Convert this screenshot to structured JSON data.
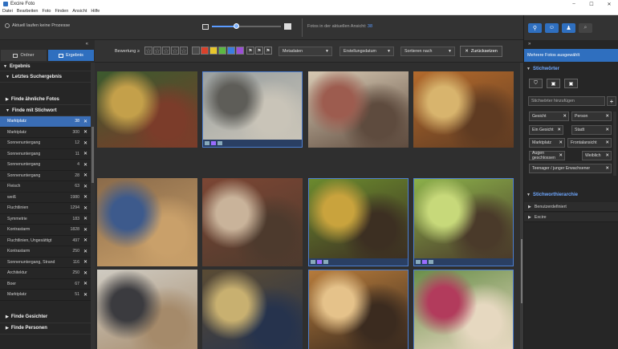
{
  "window": {
    "title": "Excire Foto",
    "minimize": "–",
    "maximize": "☐",
    "close": "✕"
  },
  "menu": [
    "Datei",
    "Bearbeiten",
    "Foto",
    "Finden",
    "Ansicht",
    "Hilfe"
  ],
  "toolbar": {
    "process_status": "Aktuell laufen keine Prozesse",
    "zoom_level": 0.35,
    "count_label": "Fotos in der aktuellen Ansicht:",
    "count_value": "38"
  },
  "left_tabs": [
    {
      "label": "Ordner",
      "active": false
    },
    {
      "label": "Ergebnis",
      "active": true
    }
  ],
  "left_panel": {
    "collapse": "«",
    "results_section": "Ergebnis",
    "last_search": "Letztes Suchergebnis",
    "similar": "Finde ähnliche Fotos",
    "by_keyword": "Finde mit Stichwort",
    "keyword_rows": [
      {
        "label": "Marktplatz",
        "count": "38",
        "selected": true
      },
      {
        "label": "Marktplatz",
        "count": "300",
        "selected": false
      },
      {
        "label": "Sonnenuntergang",
        "count": "12",
        "selected": false
      },
      {
        "label": "Sonnenuntergang",
        "count": "11",
        "selected": false
      },
      {
        "label": "Sonnenuntergang",
        "count": "4",
        "selected": false
      },
      {
        "label": "Sonnenuntergang",
        "count": "28",
        "selected": false
      },
      {
        "label": "Fleisch",
        "count": "63",
        "selected": false
      },
      {
        "label": "weiß",
        "count": "1980",
        "selected": false
      },
      {
        "label": "Fluchtlinien",
        "count": "1294",
        "selected": false
      },
      {
        "label": "Symmetrie",
        "count": "183",
        "selected": false
      },
      {
        "label": "Kontrastarm",
        "count": "1828",
        "selected": false
      },
      {
        "label": "Fluchtlinien, Ungesättigt",
        "count": "497",
        "selected": false
      },
      {
        "label": "Kontrastarm",
        "count": "250",
        "selected": false
      },
      {
        "label": "Sonnenuntergang, Strand",
        "count": "116",
        "selected": false
      },
      {
        "label": "Architektur",
        "count": "250",
        "selected": false
      },
      {
        "label": "Boer",
        "count": "67",
        "selected": false
      },
      {
        "label": "Marktplatz",
        "count": "51",
        "selected": false
      }
    ],
    "faces": "Finde Gesichter",
    "persons": "Finde Personen"
  },
  "filterbar": {
    "rating_label": "Bewertung  ≥",
    "stars": [
      "☆",
      "☆",
      "☆",
      "☆",
      "☆"
    ],
    "color_labels": [
      "#4a4a4a",
      "#d9412b",
      "#e8c62c",
      "#5cb843",
      "#3b7de0",
      "#9b4fd6"
    ],
    "flags": [
      "⚑",
      "⚑",
      "⚑"
    ],
    "metadata": "Metadaten",
    "date": "Erstellungsdatum",
    "sort": "Sortieren nach",
    "reset": "Zurücksetzen"
  },
  "photos": [
    {
      "colors": [
        "#3b5a2e",
        "#c4a04a",
        "#7b3c2a"
      ],
      "selected": false
    },
    {
      "colors": [
        "#9aa0a0",
        "#5e5d58",
        "#c9c4b8"
      ],
      "selected": true
    },
    {
      "colors": [
        "#d7c9b3",
        "#9d5c4f",
        "#5e4b3e"
      ],
      "selected": false
    },
    {
      "colors": [
        "#b36a2c",
        "#d8b46d",
        "#5f3b22"
      ],
      "selected": false
    },
    {
      "colors": [
        "#8b6b4a",
        "#3d5a8c",
        "#c9a06a"
      ],
      "selected": false
    },
    {
      "colors": [
        "#7c4634",
        "#c9b39a",
        "#4d3a2d"
      ],
      "selected": false
    },
    {
      "colors": [
        "#6b8a2e",
        "#c9a33d",
        "#3c2f22"
      ],
      "selected": true
    },
    {
      "colors": [
        "#8bb04a",
        "#c7d97a",
        "#4a3a2a"
      ],
      "selected": true
    },
    {
      "colors": [
        "#cfcbc2",
        "#3b3b3f",
        "#a58a6a"
      ],
      "selected": false
    },
    {
      "colors": [
        "#5a4b34",
        "#c8b070",
        "#26334d"
      ],
      "selected": false
    },
    {
      "colors": [
        "#b67b3b",
        "#e5c28a",
        "#3b2b1f"
      ],
      "selected": true
    },
    {
      "colors": [
        "#6a8f4a",
        "#b23b5c",
        "#e6d8c0"
      ],
      "selected": true
    }
  ],
  "right_panel": {
    "expand": "»",
    "multi_selected": "Mehrere Fotos ausgewählt",
    "keywords_section": "Stichwörter",
    "keyword_tools": [
      "⛉",
      "▣",
      "▣"
    ],
    "keyword_placeholder": "Stichwörter hinzufügen",
    "add": "+",
    "tags": [
      "Gesicht",
      "Person",
      "Ein Gesicht",
      "Stadt",
      "Marktplatz",
      "Frontalansicht",
      "Augen geschlossen",
      "Weiblich",
      "Teenager / junger Erwachsener"
    ],
    "hierarchy_section": "Stichworthierarchie",
    "hierarchy_items": [
      "Benutzerdefiniert",
      "Excire"
    ]
  },
  "accent": "#2f6fbf"
}
